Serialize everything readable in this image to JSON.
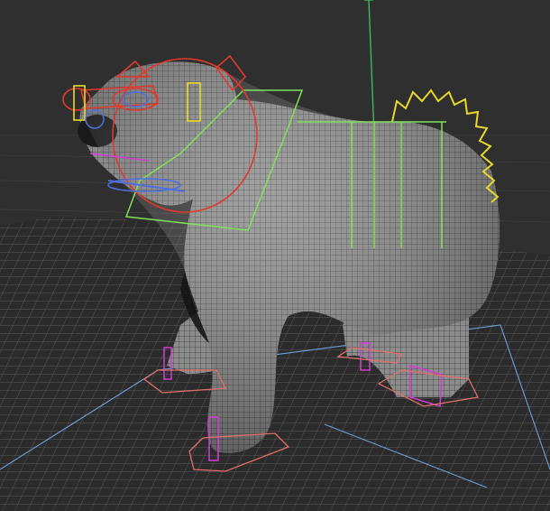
{
  "viewport": {
    "kind": "3d-perspective-viewport",
    "subject": "polar-bear-wireframe-rig",
    "colors": {
      "background": "#2f2f2f",
      "grid": "#5a5a5a",
      "ground_wire": "#7a7a7a",
      "mesh_fill": "#8a8a8a",
      "mesh_wire": "#3c3c3c",
      "axis_y": "#3fbf6a",
      "axis_ground": "#6ea0d8",
      "control_green": "#7fe35a",
      "control_red": "#e03a2e",
      "control_yellow": "#e8d82a",
      "control_blue": "#4f6fe0",
      "control_magenta": "#d63ad6",
      "control_salmon": "#e0706a"
    }
  }
}
